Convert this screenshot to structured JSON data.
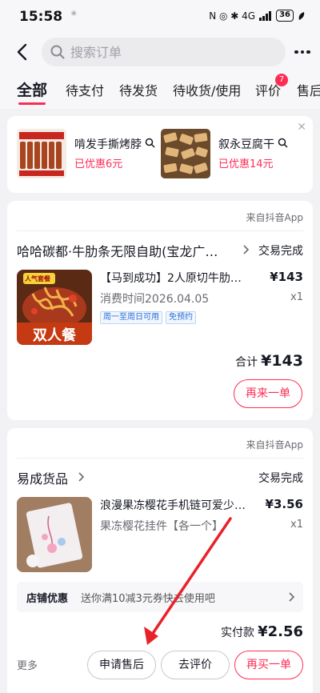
{
  "status_bar": {
    "time": "15:58",
    "indicator": "✳",
    "icons_text": "N ◎ ✱ 4G",
    "battery": "36"
  },
  "header": {
    "search_placeholder": "搜索订单"
  },
  "tabs": {
    "items": [
      "全部",
      "待支付",
      "待发货",
      "待收货/使用",
      "评价",
      "售后"
    ],
    "active": "全部",
    "review_badge": "7"
  },
  "recommendations": [
    {
      "title": "啃发手撕烤脖",
      "discount": "已优惠6元"
    },
    {
      "title": "叙永豆腐干",
      "discount": "已优惠14元"
    }
  ],
  "orders": [
    {
      "source": "来自抖音App",
      "shop": "哈哈碳都·牛肋条无限自助(宝龙广…",
      "status": "交易完成",
      "thumb_text": "双人餐",
      "thumb_badge": "人气套餐",
      "product_title": "【马到成功】2人原切牛肋…",
      "price": "¥143",
      "meta": "消费时间2026.04.05",
      "qty": "x1",
      "tags": [
        "周一至周日可用",
        "免预约"
      ],
      "total_label": "合计",
      "total": "¥143",
      "buttons": [
        "再来一单"
      ]
    },
    {
      "source": "来自抖音App",
      "shop": "易成货品",
      "status": "交易完成",
      "product_title": "浪漫果冻樱花手机链可爱少…",
      "price": "¥3.56",
      "meta": "果冻樱花挂件【各一个】",
      "qty": "x1",
      "promo_label": "店铺优惠",
      "promo_text": "送你满10减3元券快去使用吧",
      "paid_label": "实付款",
      "paid": "¥2.56",
      "more": "更多",
      "buttons": [
        "申请售后",
        "去评价",
        "再买一单"
      ]
    }
  ],
  "colors": {
    "accent": "#fe2c55",
    "annotation_arrow": "#e8222b"
  }
}
